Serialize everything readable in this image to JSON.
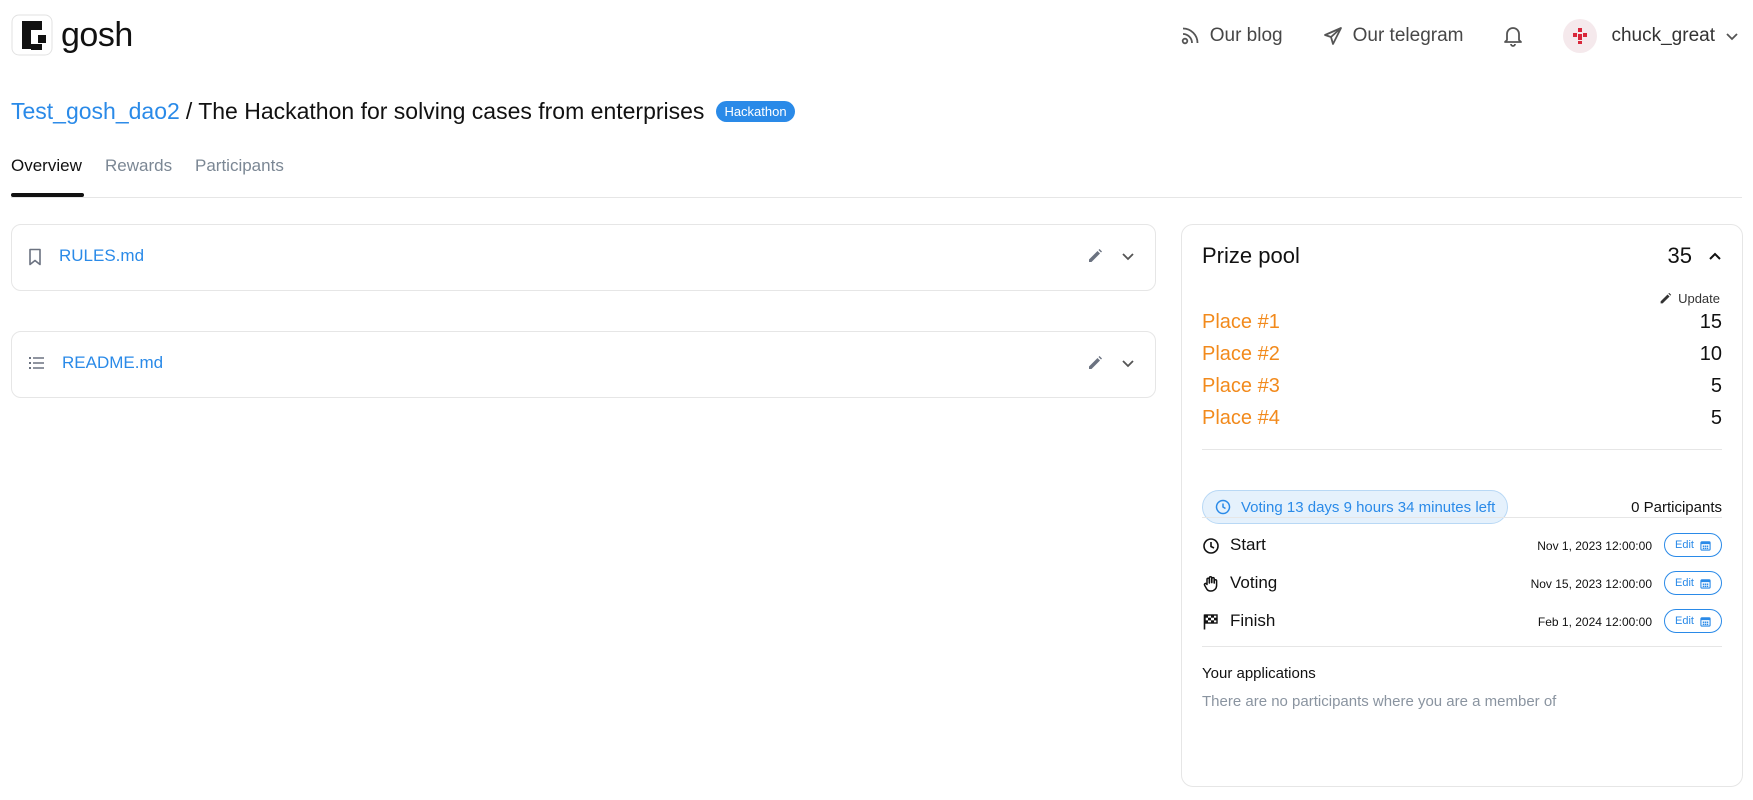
{
  "header": {
    "logo_text": "gosh",
    "blog_label": "Our blog",
    "telegram_label": "Our telegram",
    "username": "chuck_great"
  },
  "title": {
    "dao_name": "Test_gosh_dao2",
    "separator": "/",
    "task_name": "The Hackathon for solving cases from enterprises",
    "badge": "Hackathon"
  },
  "tabs": [
    {
      "label": "Overview",
      "active": true
    },
    {
      "label": "Rewards",
      "active": false
    },
    {
      "label": "Participants",
      "active": false
    }
  ],
  "docs": [
    {
      "name": "RULES.md",
      "icon": "bookmark-icon"
    },
    {
      "name": "README.md",
      "icon": "list-icon"
    }
  ],
  "prize_pool": {
    "title": "Prize pool",
    "total": "35",
    "update_label": "Update",
    "places": [
      {
        "label": "Place #1",
        "value": "15"
      },
      {
        "label": "Place #2",
        "value": "10"
      },
      {
        "label": "Place #3",
        "value": "5"
      },
      {
        "label": "Place #4",
        "value": "5"
      }
    ],
    "voting_status": "Voting 13 days 9 hours 34 minutes left",
    "participants": "0 Participants",
    "dates": [
      {
        "label": "Start",
        "value": "Nov 1, 2023 12:00:00",
        "edit": "Edit",
        "icon": "clock-icon"
      },
      {
        "label": "Voting",
        "value": "Nov 15, 2023 12:00:00",
        "edit": "Edit",
        "icon": "hand-icon"
      },
      {
        "label": "Finish",
        "value": "Feb 1, 2024 12:00:00",
        "edit": "Edit",
        "icon": "flag-icon"
      }
    ],
    "applications_title": "Your applications",
    "applications_empty": "There are no participants where you are a member of"
  },
  "colors": {
    "accent": "#2a8ae8",
    "place": "#f28a1c",
    "muted": "#7b8794"
  }
}
